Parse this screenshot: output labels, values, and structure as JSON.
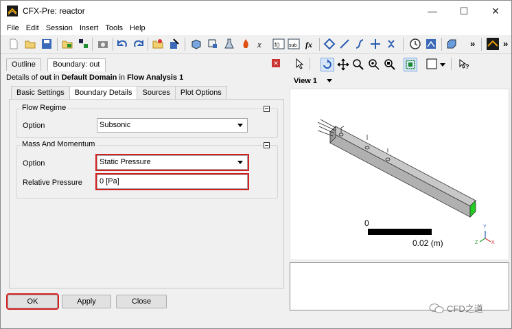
{
  "window": {
    "title": "CFX-Pre:  reactor",
    "minimize": "—",
    "maximize": "☐",
    "close": "✕"
  },
  "menu": [
    "File",
    "Edit",
    "Session",
    "Insert",
    "Tools",
    "Help"
  ],
  "left_panel": {
    "tabs": [
      "Outline",
      "Boundary: out"
    ],
    "details": {
      "prefix": "Details of ",
      "name": "out",
      "in1": " in ",
      "domain": "Default Domain",
      "in2": " in ",
      "analysis": "Flow Analysis 1"
    },
    "subtabs": [
      "Basic Settings",
      "Boundary Details",
      "Sources",
      "Plot Options"
    ],
    "flow_regime": {
      "title": "Flow Regime",
      "option_label": "Option",
      "option_value": "Subsonic"
    },
    "mass_momentum": {
      "title": "Mass And Momentum",
      "option_label": "Option",
      "option_value": "Static Pressure",
      "rel_label": "Relative Pressure",
      "rel_value": "0 [Pa]"
    },
    "buttons": {
      "ok": "OK",
      "apply": "Apply",
      "close": "Close"
    }
  },
  "right_panel": {
    "view_label": "View 1",
    "scale_zero": "0",
    "scale_value": "0.02  (m)",
    "axes": {
      "x": "X",
      "y": "Y",
      "z": "Z"
    }
  },
  "watermark": "CFD之道",
  "colors": {
    "accent_red": "#d32020",
    "outlet_green": "#22cc22"
  }
}
